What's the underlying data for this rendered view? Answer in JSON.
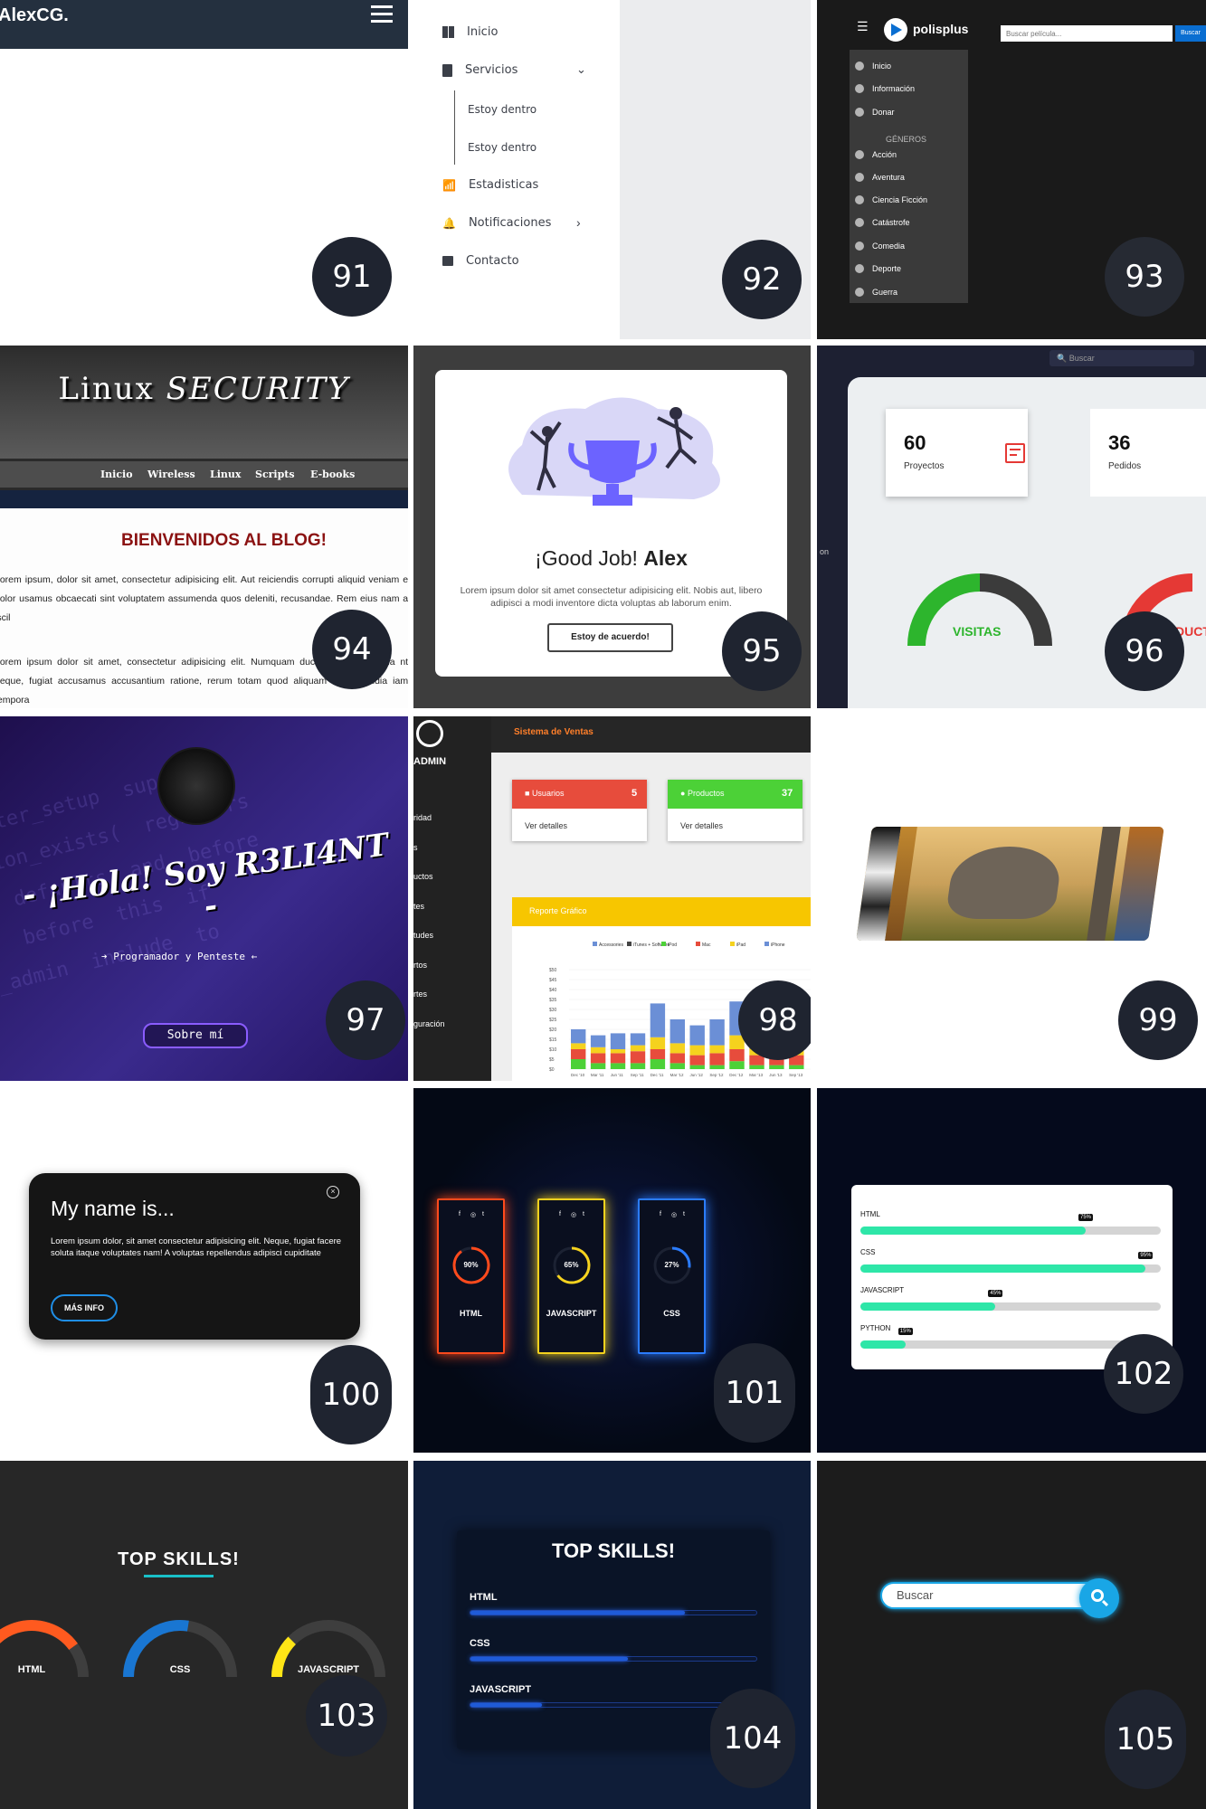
{
  "tile_numbers": [
    "91",
    "92",
    "93",
    "94",
    "95",
    "96",
    "97",
    "98",
    "99",
    "100",
    "101",
    "102",
    "103",
    "104",
    "105"
  ],
  "t91": {
    "logo": "AlexCG."
  },
  "t92": {
    "items": [
      "Inicio",
      "Servicios",
      "Estoy dentro",
      "Estoy dentro",
      "Estadisticas",
      "Notificaciones",
      "Contacto"
    ]
  },
  "t93": {
    "brand": "polisplus",
    "search_placeholder": "Buscar película...",
    "search_button": "Buscar",
    "nav": [
      "Inicio",
      "Información",
      "Donar"
    ],
    "genres_title": "GÉNEROS",
    "genres": [
      "Acción",
      "Aventura",
      "Ciencia Ficción",
      "Catástrofe",
      "Comedia",
      "Deporte",
      "Guerra"
    ]
  },
  "t94": {
    "title_a": "Linux ",
    "title_b": "SECURITY",
    "nav": [
      "Inicio",
      "Wireless",
      "Linux",
      "Scripts",
      "E-books"
    ],
    "heading": "BIENVENIDOS AL BLOG!",
    "para1": "Lorem ipsum, dolor sit amet, consectetur adipisicing elit. Aut reiciendis corrupti aliquid veniam et dolor usamus obcaecati sint voluptatem assumenda quos deleniti, recusandae. Rem eius nam at iscil",
    "para2": "Lorem ipsum dolor sit amet, consectetur adipisicing elit. Numquam ducimus, quis aperna nt, neque, fugiat accusamus accusantium ratione, rerum totam quod aliquam cum repudia iam, tempora"
  },
  "t95": {
    "title_prefix": "¡Good Job! ",
    "title_name": "Alex",
    "body": "Lorem ipsum dolor sit amet consectetur adipisicing elit. Nobis aut, libero adipisci a modi inventore dicta voluptas ab laborum enim.",
    "button": "Estoy de acuerdo!"
  },
  "t96": {
    "search_placeholder": "Buscar",
    "kpis": [
      {
        "value": "60",
        "label": "Proyectos"
      },
      {
        "value": "36",
        "label": "Pedidos"
      }
    ],
    "gauge_label": "VISITAS",
    "gauge2_label": "DUCT",
    "side_text": "on"
  },
  "t97": {
    "greeting": "- ¡Hola! Soy R3LI4NT -",
    "subtitle": "Programador y Penteste",
    "button": "Sobre mí"
  },
  "t98": {
    "avatar_label": "ADMIN",
    "app_title": "Sistema de Ventas",
    "menu": [
      "ridad",
      "s",
      "uctos",
      "tes",
      "tudes",
      "rtos",
      "rtes",
      "guración"
    ],
    "cards": [
      {
        "title": "Usuarios",
        "count": "5",
        "link": "Ver detalles",
        "color": "#e74c3c"
      },
      {
        "title": "Productos",
        "count": "37",
        "link": "Ver detalles",
        "color": "#4cd137"
      }
    ],
    "report_title": "Reporte Gráfico"
  },
  "t100": {
    "title": "My name is...",
    "body": "Lorem ipsum dolor, sit amet consectetur adipisicing elit. Neque, fugiat facere soluta itaque voluptates nam! A voluptas repellendus adipisci cupiditate",
    "button": "MÁS INFO"
  },
  "t101": {
    "cards": [
      {
        "pct": "90%",
        "label": "HTML",
        "color": "#ff4a1c",
        "value": 0.9
      },
      {
        "pct": "65%",
        "label": "JAVASCRIPT",
        "color": "#f5d21e",
        "value": 0.65
      },
      {
        "pct": "27%",
        "label": "CSS",
        "color": "#2b7cff",
        "value": 0.27
      }
    ],
    "social": [
      "f",
      "◎",
      "t"
    ]
  },
  "t102": {
    "skills": [
      {
        "label": "HTML",
        "pct": "75%",
        "value": 0.75
      },
      {
        "label": "CSS",
        "pct": "95%",
        "value": 0.95
      },
      {
        "label": "JAVASCRIPT",
        "pct": "45%",
        "value": 0.45
      },
      {
        "label": "PYTHON",
        "pct": "15%",
        "value": 0.15
      }
    ]
  },
  "t103": {
    "title": "TOP SKILLS!",
    "skills": [
      {
        "label": "HTML",
        "color": "#ff5a1f",
        "value": 0.8
      },
      {
        "label": "CSS",
        "color": "#1976d2",
        "value": 0.55
      },
      {
        "label": "JAVASCRIPT",
        "color": "#ffe516",
        "value": 0.25
      }
    ]
  },
  "t104": {
    "title": "TOP SKILLS!",
    "skills": [
      {
        "label": "HTML",
        "value": 0.75
      },
      {
        "label": "CSS",
        "value": 0.55
      },
      {
        "label": "JAVASCRIPT",
        "value": 0.25
      }
    ]
  },
  "t105": {
    "search_placeholder": "Buscar"
  },
  "chart_data": {
    "type": "bar",
    "stacked": true,
    "legend": [
      "Accessories",
      "iTunes + Software",
      "iPod",
      "Mac",
      "iPad",
      "iPhone"
    ],
    "colors": [
      "#6b8fd6",
      "#444444",
      "#4cd137",
      "#e74c3c",
      "#f5d21e",
      "#6b8fd6"
    ],
    "categories": [
      "Dec '10",
      "Mar '11",
      "Jun '11",
      "Sep '11",
      "Dec '11",
      "Mar '12",
      "Jun '12",
      "Sep '12",
      "Dec '12",
      "Mar '13",
      "Jun '13",
      "Sep '13"
    ],
    "yticks": [
      "$0",
      "$5",
      "$10",
      "$15",
      "$20",
      "$25",
      "$30",
      "$35",
      "$40",
      "$45",
      "$50"
    ],
    "series": [
      {
        "name": "iPhone",
        "values": [
          7,
          6,
          8,
          6,
          17,
          12,
          10,
          13,
          17,
          12,
          10,
          12
        ]
      },
      {
        "name": "iPad",
        "values": [
          3,
          3,
          2,
          3,
          6,
          5,
          5,
          4,
          7,
          5,
          4,
          4
        ]
      },
      {
        "name": "Mac",
        "values": [
          5,
          5,
          5,
          6,
          5,
          5,
          5,
          6,
          6,
          5,
          5,
          5
        ]
      },
      {
        "name": "iPod",
        "values": [
          5,
          3,
          3,
          3,
          5,
          3,
          2,
          2,
          4,
          2,
          2,
          2
        ]
      }
    ]
  }
}
